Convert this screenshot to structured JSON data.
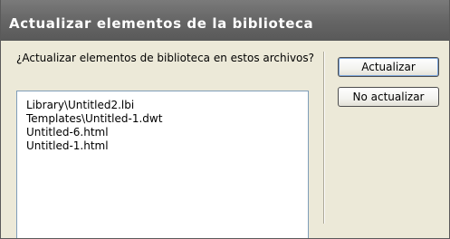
{
  "dialog": {
    "title": "Actualizar elementos de la biblioteca",
    "question": "¿Actualizar elementos de biblioteca en estos archivos?",
    "files": [
      "Library\\Untitled2.lbi",
      "Templates\\Untitled-1.dwt",
      "Untitled-6.html",
      "Untitled-1.html"
    ],
    "buttons": {
      "update_label": "Actualizar",
      "no_update_label": "No actualizar"
    }
  }
}
